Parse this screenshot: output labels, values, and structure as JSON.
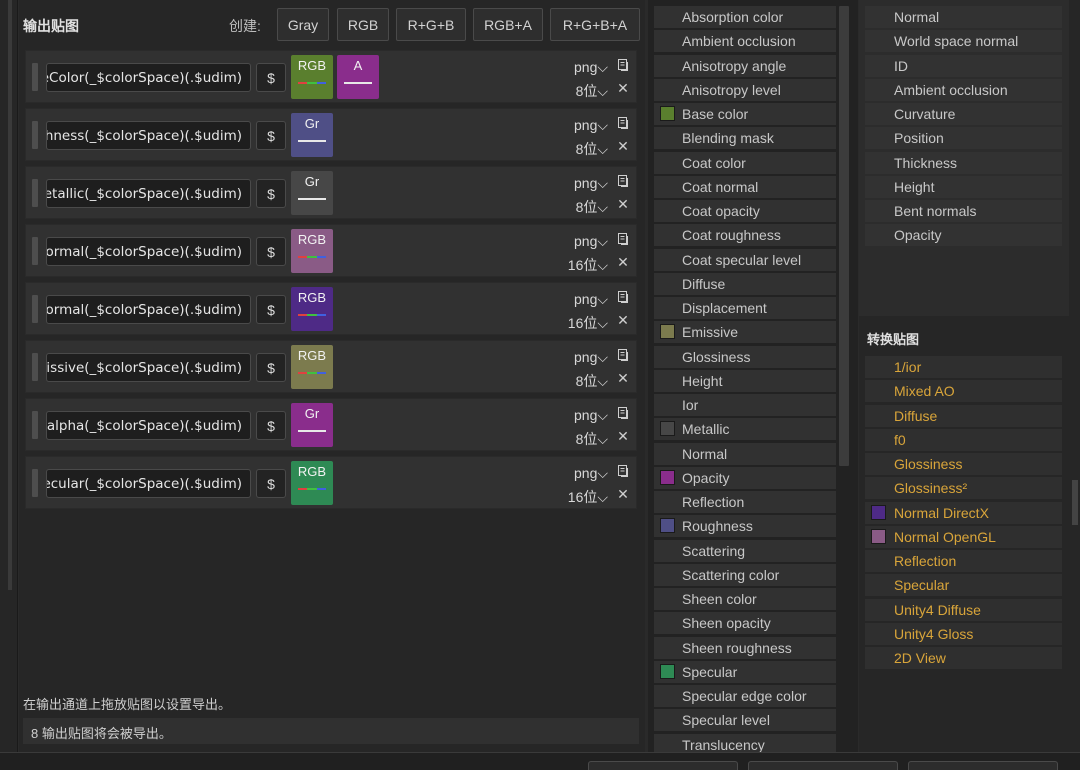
{
  "output_panel": {
    "title": "输出贴图",
    "create_label": "创建:",
    "create_buttons": [
      "Gray",
      "RGB",
      "R+G+B",
      "RGB+A",
      "R+G+B+A"
    ],
    "rows": [
      {
        "name": "eColor(_$colorSpace)(.$udim)",
        "format": "png",
        "bits": "8位",
        "chips": [
          {
            "label": "RGB",
            "color": "#5a7f2e",
            "type": "rgb"
          },
          {
            "label": "A",
            "color": "#8a2d8c",
            "type": "single"
          }
        ]
      },
      {
        "name": "ghness(_$colorSpace)(.$udim)",
        "format": "png",
        "bits": "8位",
        "chips": [
          {
            "label": "Gr",
            "color": "#4f4f86",
            "type": "single"
          }
        ]
      },
      {
        "name": "letallic(_$colorSpace)(.$udim)",
        "format": "png",
        "bits": "8位",
        "chips": [
          {
            "label": "Gr",
            "color": "#474747",
            "type": "single"
          }
        ]
      },
      {
        "name": "Normal(_$colorSpace)(.$udim)",
        "format": "png",
        "bits": "16位",
        "chips": [
          {
            "label": "RGB",
            "color": "#8a5b86",
            "type": "rgb"
          }
        ]
      },
      {
        "name": "Normal(_$colorSpace)(.$udim)",
        "format": "png",
        "bits": "16位",
        "chips": [
          {
            "label": "RGB",
            "color": "#4e2a86",
            "type": "rgb"
          }
        ]
      },
      {
        "name": "nissive(_$colorSpace)(.$udim)",
        "format": "png",
        "bits": "8位",
        "chips": [
          {
            "label": "RGB",
            "color": "#7c7b4e",
            "type": "rgb"
          }
        ]
      },
      {
        "name": "_alpha(_$colorSpace)(.$udim)",
        "format": "png",
        "bits": "8位",
        "chips": [
          {
            "label": "Gr",
            "color": "#8a2d8c",
            "type": "single"
          }
        ]
      },
      {
        "name": "pecular(_$colorSpace)(.$udim)",
        "format": "png",
        "bits": "16位",
        "chips": [
          {
            "label": "RGB",
            "color": "#2e8a54",
            "type": "rgb"
          }
        ]
      }
    ],
    "dollar": "$",
    "hint": "在输出通道上拖放贴图以设置导出。",
    "status": "8 输出贴图将会被导出。"
  },
  "channels": [
    {
      "label": "Absorption color",
      "swatch": ""
    },
    {
      "label": "Ambient occlusion",
      "swatch": ""
    },
    {
      "label": "Anisotropy angle",
      "swatch": ""
    },
    {
      "label": "Anisotropy level",
      "swatch": ""
    },
    {
      "label": "Base color",
      "swatch": "#5a7f2e"
    },
    {
      "label": "Blending mask",
      "swatch": ""
    },
    {
      "label": "Coat color",
      "swatch": ""
    },
    {
      "label": "Coat normal",
      "swatch": ""
    },
    {
      "label": "Coat opacity",
      "swatch": ""
    },
    {
      "label": "Coat roughness",
      "swatch": ""
    },
    {
      "label": "Coat specular level",
      "swatch": ""
    },
    {
      "label": "Diffuse",
      "swatch": ""
    },
    {
      "label": "Displacement",
      "swatch": ""
    },
    {
      "label": "Emissive",
      "swatch": "#7c7b4e"
    },
    {
      "label": "Glossiness",
      "swatch": ""
    },
    {
      "label": "Height",
      "swatch": ""
    },
    {
      "label": "Ior",
      "swatch": ""
    },
    {
      "label": "Metallic",
      "swatch": "#474747"
    },
    {
      "label": "Normal",
      "swatch": ""
    },
    {
      "label": "Opacity",
      "swatch": "#8a2d8c"
    },
    {
      "label": "Reflection",
      "swatch": ""
    },
    {
      "label": "Roughness",
      "swatch": "#4f4f86"
    },
    {
      "label": "Scattering",
      "swatch": ""
    },
    {
      "label": "Scattering color",
      "swatch": ""
    },
    {
      "label": "Sheen color",
      "swatch": ""
    },
    {
      "label": "Sheen opacity",
      "swatch": ""
    },
    {
      "label": "Sheen roughness",
      "swatch": ""
    },
    {
      "label": "Specular",
      "swatch": "#2e8a54"
    },
    {
      "label": "Specular edge color",
      "swatch": ""
    },
    {
      "label": "Specular level",
      "swatch": ""
    },
    {
      "label": "Translucency",
      "swatch": ""
    }
  ],
  "mesh_maps": [
    "Normal",
    "World space normal",
    "ID",
    "Ambient occlusion",
    "Curvature",
    "Position",
    "Thickness",
    "Height",
    "Bent normals",
    "Opacity"
  ],
  "converted": {
    "title": "转换贴图",
    "items": [
      {
        "label": "1/ior",
        "swatch": ""
      },
      {
        "label": "Mixed AO",
        "swatch": ""
      },
      {
        "label": "Diffuse",
        "swatch": ""
      },
      {
        "label": "f0",
        "swatch": ""
      },
      {
        "label": "Glossiness",
        "swatch": ""
      },
      {
        "label": "Glossiness²",
        "swatch": ""
      },
      {
        "label": "Normal DirectX",
        "swatch": "#4e2a86"
      },
      {
        "label": "Normal OpenGL",
        "swatch": "#8a5b86"
      },
      {
        "label": "Reflection",
        "swatch": ""
      },
      {
        "label": "Specular",
        "swatch": ""
      },
      {
        "label": "Unity4 Diffuse",
        "swatch": ""
      },
      {
        "label": "Unity4 Gloss",
        "swatch": ""
      },
      {
        "label": "2D View",
        "swatch": ""
      }
    ]
  }
}
